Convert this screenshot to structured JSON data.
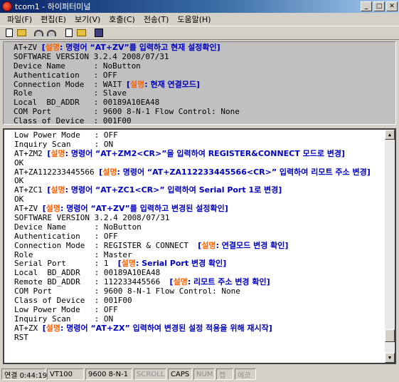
{
  "window": {
    "title": "tcom1 - 하이퍼터미널"
  },
  "menu": [
    "파일(F)",
    "편집(E)",
    "보기(V)",
    "호출(C)",
    "전송(T)",
    "도움말(H)"
  ],
  "upper": [
    {
      "t": "AT+ZV ",
      "c": "[설명: 명령어 “AT+ZV”를 입력하고 현재 설정확인]"
    },
    {
      "t": "SOFTWARE VERSION 3.2.4 2008/07/31"
    },
    {
      "t": "Device Name      : NoButton"
    },
    {
      "t": "Authentication   : OFF"
    },
    {
      "t": "Connection Mode  : WAIT ",
      "c": "[설명: 현재 연결모드]"
    },
    {
      "t": "Role             : Slave"
    },
    {
      "t": "Local  BD_ADDR   : 00189A10EA48"
    },
    {
      "t": "COM Port         : 9600 8-N-1 Flow Control: None"
    },
    {
      "t": "Class of Device  : 001F00"
    }
  ],
  "lower": [
    {
      "t": "Low Power Mode   : OFF"
    },
    {
      "t": "Inquiry Scan     : ON"
    },
    {
      "t": "AT+ZM2 ",
      "c": "[설명: 명령어 “AT+ZM2<CR>”을 입력하여 REGISTER&CONNECT 모드로 변경]"
    },
    {
      "t": "OK"
    },
    {
      "t": "AT+ZA112233445566 ",
      "c": "[설명: 명령어 “AT+ZA112233445566<CR>” 입력하여 리모트 주소 변경]"
    },
    {
      "t": "OK"
    },
    {
      "t": "AT+ZC1 ",
      "c": "[설명: 명령어 “AT+ZC1<CR>” 입력하여 Serial Port 1로 변경]"
    },
    {
      "t": "OK"
    },
    {
      "t": "AT+ZV ",
      "c": "[설명: 명령어 “AT+ZV”를 입력하고 변경된 설정확인]"
    },
    {
      "t": "SOFTWARE VERSION 3.2.4 2008/07/31"
    },
    {
      "t": "Device Name      : NoButton"
    },
    {
      "t": "Authentication   : OFF"
    },
    {
      "t": "Connection Mode  : REGISTER & CONNECT  ",
      "c": "[설명: 연결모드 변경 확인]"
    },
    {
      "t": "Role             : Master"
    },
    {
      "t": "Serial Port      : 1  ",
      "c": "[설명: Serial Port 변경 확인]"
    },
    {
      "t": "Local  BD_ADDR   : 00189A10EA48"
    },
    {
      "t": "Remote BD_ADDR   : 112233445566  ",
      "c": "[설명: 리모트 주소 변경 확인]"
    },
    {
      "t": "COM Port         : 9600 8-N-1 Flow Control: None"
    },
    {
      "t": "Class of Device  : 001F00"
    },
    {
      "t": "Low Power Mode   : OFF"
    },
    {
      "t": "Inquiry Scan     : ON"
    },
    {
      "t": "AT+ZX ",
      "c": "[설명: 명령어 “AT+ZX” 입력하여 변경된 설정 적용을 위해 재시작]"
    },
    {
      "t": "RST"
    }
  ],
  "status": {
    "connected": "연결 0:44:19",
    "emulation": "VT100",
    "port": "9600 8-N-1",
    "scroll": "SCROLL",
    "caps": "CAPS",
    "num": "NUM",
    "capture": "캡",
    "echo": "에코"
  },
  "comment_label": "설명"
}
